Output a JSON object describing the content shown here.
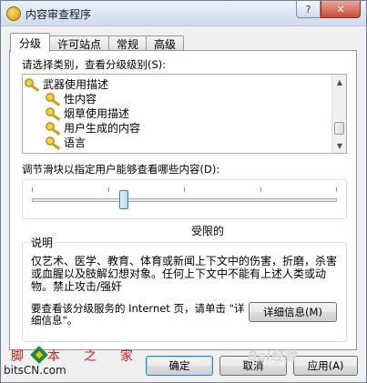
{
  "window": {
    "title": "内容审查程序",
    "help_glyph": "?",
    "close_glyph": "✕"
  },
  "tabs": [
    {
      "label": "分级",
      "active": true
    },
    {
      "label": "许可站点",
      "active": false
    },
    {
      "label": "常规",
      "active": false
    },
    {
      "label": "高级",
      "active": false
    }
  ],
  "rating": {
    "category_label": "请选择类别，查看分级级别(S):",
    "categories": [
      {
        "label": "武器使用描述",
        "icon": "key-icon"
      },
      {
        "label": "性内容",
        "icon": "key-icon"
      },
      {
        "label": "烟草使用描述",
        "icon": "key-icon"
      },
      {
        "label": "用户生成的内容",
        "icon": "key-icon"
      },
      {
        "label": "语言",
        "icon": "key-icon"
      }
    ],
    "slider_label": "调节滑块以指定用户能够查看哪些内容(D):",
    "slider_level": "受限的",
    "slider_position": 0.3,
    "slider_ticks": 5
  },
  "description": {
    "title": "说明",
    "text": "仅艺术、医学、教育、体育或新闻上下文中的伤害，折磨，杀害或血腥以及肢解幻想对象。任何上下文中不能有上述人类或动物。禁止攻击/强奸",
    "more_info_text": "要查看该分级服务的 Internet 页，请单击 \"详细信息\"。",
    "details_button": "详细信息(M)"
  },
  "footer": {
    "ok": "确定",
    "cancel": "取消",
    "apply": "应用(A)"
  },
  "watermark": {
    "left_brand": "bitsCN.com",
    "left_cn": "脚本之家",
    "right_brand": "Bai经验"
  },
  "colors": {
    "accent": "#3c7fb1",
    "titlebar_top": "#eaf1fa",
    "close_button": "#c74a33",
    "key_gold": "#c9a018"
  }
}
